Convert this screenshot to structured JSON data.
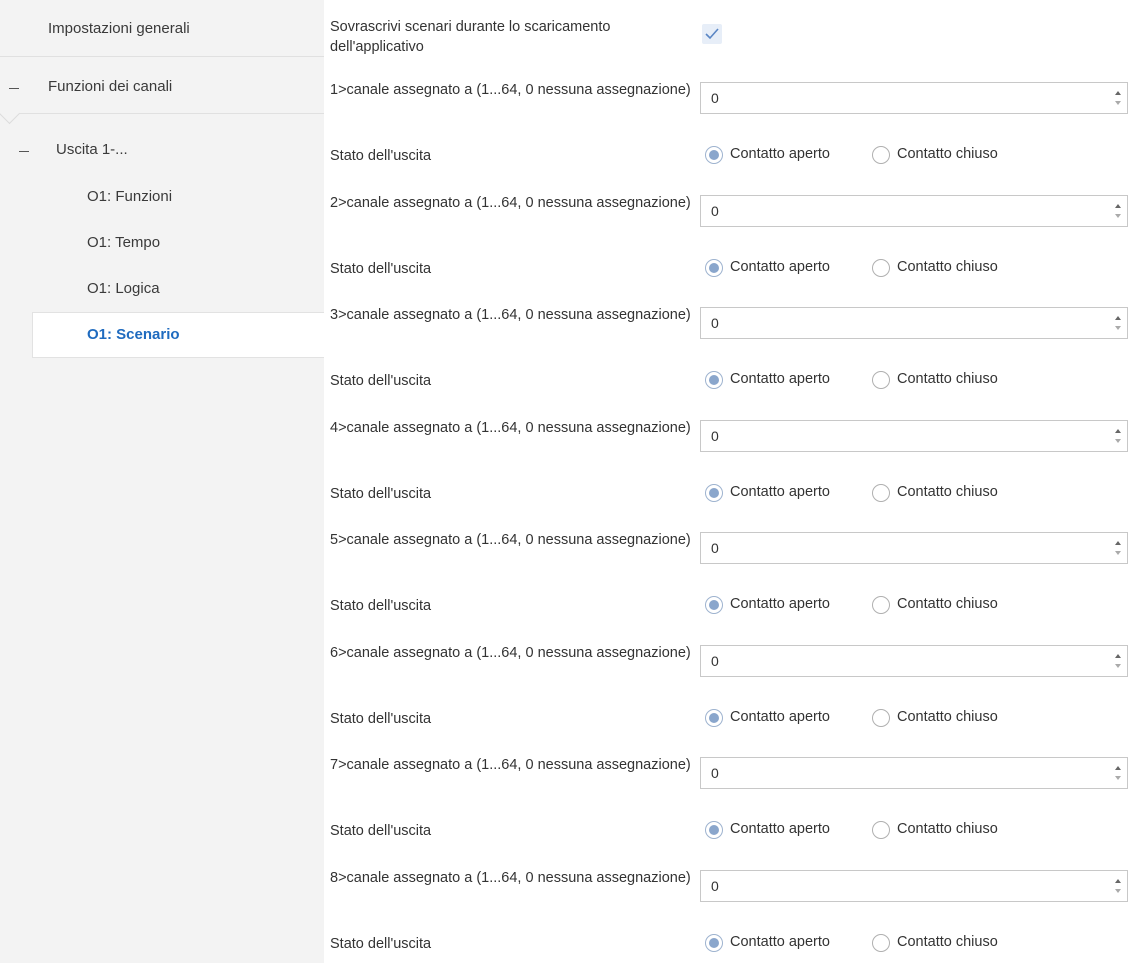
{
  "sidebar": {
    "items": [
      {
        "label": "Impostazioni generali"
      },
      {
        "label": "Funzioni dei canali"
      },
      {
        "label": "Uscita 1-..."
      },
      {
        "label": "O1: Funzioni"
      },
      {
        "label": "O1: Tempo"
      },
      {
        "label": "O1: Logica"
      },
      {
        "label": "O1: Scenario"
      }
    ],
    "selected": "O1: Scenario",
    "accent_color": "#1f6bbf"
  },
  "form": {
    "overwrite": {
      "label": "Sovrascrivi scenari durante lo scaricamento dell'applicativo",
      "checked": true
    },
    "state_label": "Stato dell'uscita",
    "radio_options": [
      "Contatto aperto",
      "Contatto chiuso"
    ],
    "channels": [
      {
        "label": "1>canale assegnato a (1...64, 0 nessuna assegnazione)",
        "value": "0",
        "state": "Contatto aperto"
      },
      {
        "label": "2>canale assegnato a (1...64, 0 nessuna assegnazione)",
        "value": "0",
        "state": "Contatto aperto"
      },
      {
        "label": "3>canale assegnato a (1...64, 0 nessuna assegnazione)",
        "value": "0",
        "state": "Contatto aperto"
      },
      {
        "label": "4>canale assegnato a (1...64, 0 nessuna assegnazione)",
        "value": "0",
        "state": "Contatto aperto"
      },
      {
        "label": "5>canale assegnato a (1...64, 0 nessuna assegnazione)",
        "value": "0",
        "state": "Contatto aperto"
      },
      {
        "label": "6>canale assegnato a (1...64, 0 nessuna assegnazione)",
        "value": "0",
        "state": "Contatto aperto"
      },
      {
        "label": "7>canale assegnato a (1...64, 0 nessuna assegnazione)",
        "value": "0",
        "state": "Contatto aperto"
      },
      {
        "label": "8>canale assegnato a (1...64, 0 nessuna assegnazione)",
        "value": "0",
        "state": "Contatto aperto"
      }
    ]
  }
}
